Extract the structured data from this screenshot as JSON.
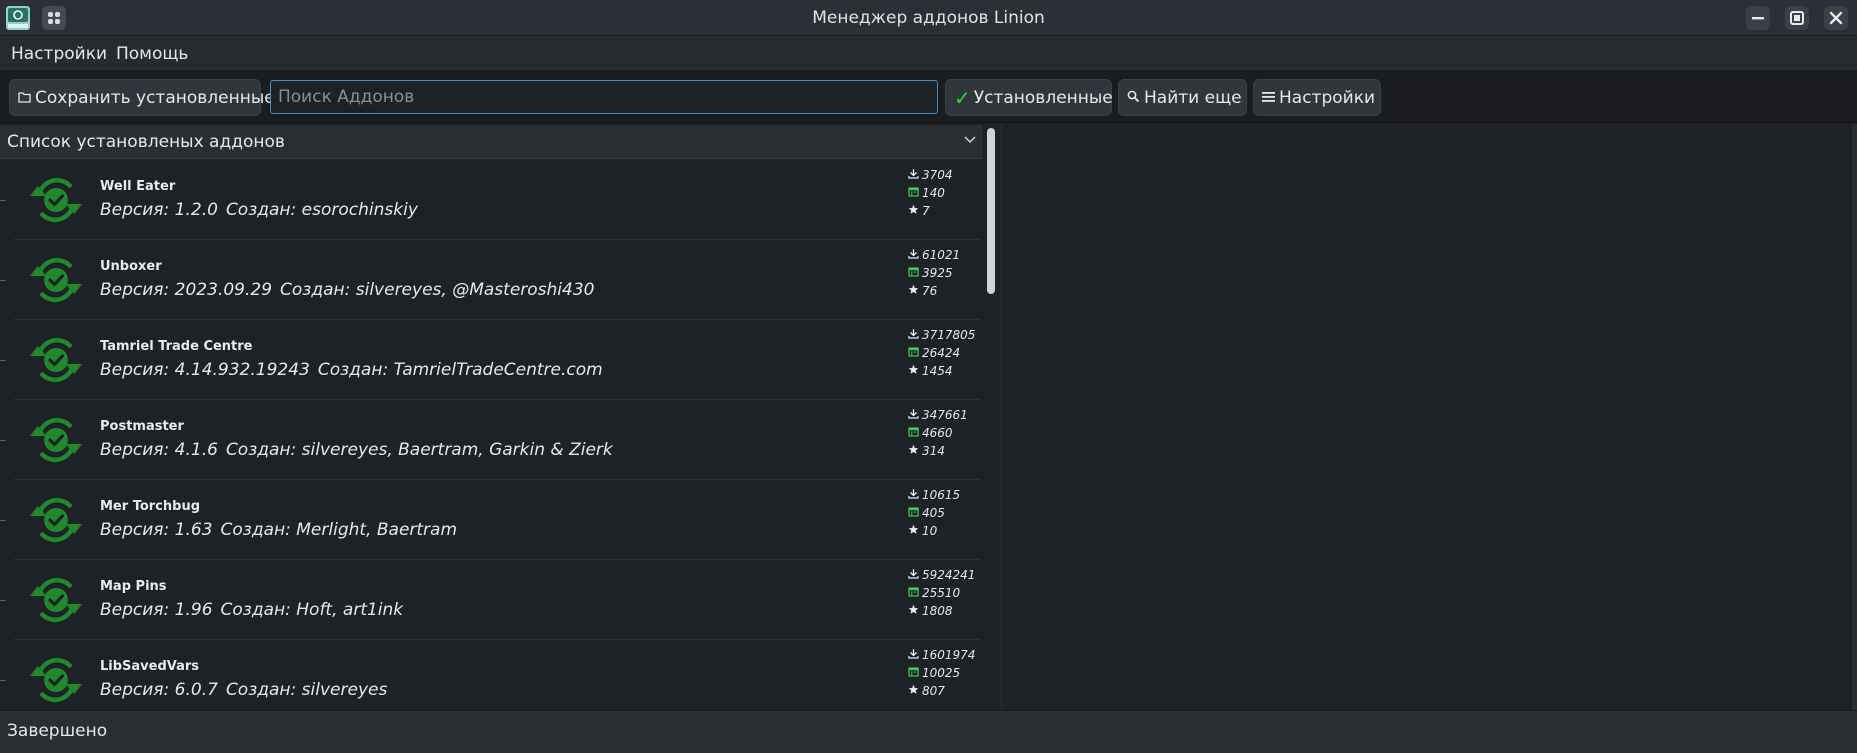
{
  "window": {
    "title": "Менеджер аддонов Linion",
    "app_icon": "linion-app-icon",
    "controls": [
      "minimize-icon",
      "maximize-icon",
      "close-icon"
    ]
  },
  "menubar": {
    "items": [
      "Настройки",
      "Помощь"
    ]
  },
  "toolbar": {
    "save_label": "Сохранить установленные",
    "search_placeholder": "Поиск Аддонов",
    "search_value": "",
    "installed_label": "Установленные",
    "find_more_label": "Найти еще",
    "settings_label": "Настройки"
  },
  "list": {
    "header": "Список установленых аддонов",
    "version_prefix": "Версия:",
    "author_prefix": "Создан:",
    "status_icon": "installed-sync-check-icon",
    "stat_icons": [
      "download-icon",
      "calendar-icon",
      "star-icon"
    ],
    "addons": [
      {
        "name": "Well Eater",
        "version": "1.2.0",
        "author": "esorochinskiy",
        "downloads": "3704",
        "monthly": "140",
        "favorites": "7"
      },
      {
        "name": "Unboxer",
        "version": "2023.09.29",
        "author": "silvereyes, @Masteroshi430",
        "downloads": "61021",
        "monthly": "3925",
        "favorites": "76"
      },
      {
        "name": "Tamriel Trade Centre",
        "version": "4.14.932.19243",
        "author": "TamrielTradeCentre.com",
        "downloads": "3717805",
        "monthly": "26424",
        "favorites": "1454"
      },
      {
        "name": "Postmaster",
        "version": "4.1.6",
        "author": "silvereyes, Baertram, Garkin & Zierk",
        "downloads": "347661",
        "monthly": "4660",
        "favorites": "314"
      },
      {
        "name": "Mer Torchbug",
        "version": "1.63",
        "author": "Merlight, Baertram",
        "downloads": "10615",
        "monthly": "405",
        "favorites": "10"
      },
      {
        "name": "Map Pins",
        "version": "1.96",
        "author": "Hoft, art1ink",
        "downloads": "5924241",
        "monthly": "25510",
        "favorites": "1808"
      },
      {
        "name": "LibSavedVars",
        "version": "6.0.7",
        "author": "silvereyes",
        "downloads": "1601974",
        "monthly": "10025",
        "favorites": "807"
      }
    ]
  },
  "statusbar": {
    "text": "Завершено"
  },
  "colors": {
    "background": "#1e2125",
    "accent_green": "#1f8a2c",
    "check_green": "#2ed43a",
    "focus_blue": "#3d8fd0"
  }
}
